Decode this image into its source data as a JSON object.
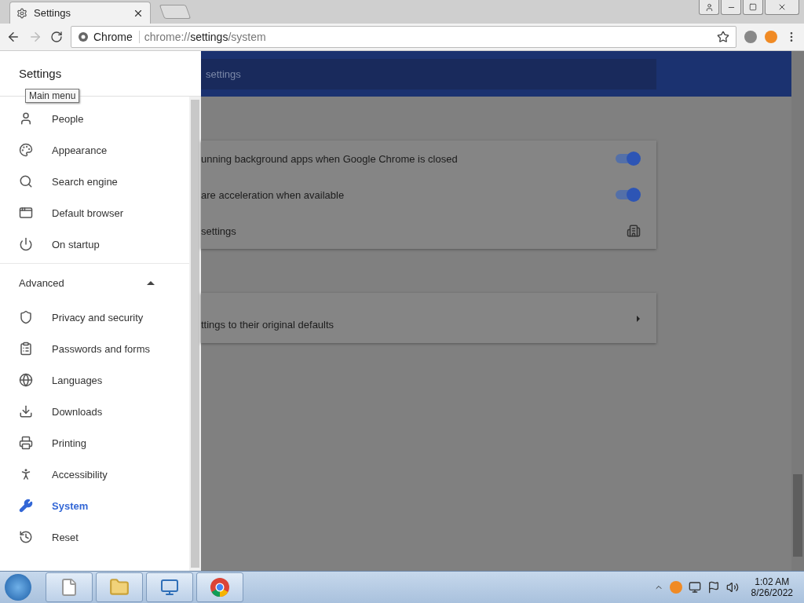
{
  "browser": {
    "tab": {
      "title": "Settings"
    },
    "address": {
      "site_label": "Chrome",
      "url_scheme": "chrome://",
      "url_host": "settings",
      "url_path": "/system"
    }
  },
  "drawer": {
    "title": "Settings",
    "tooltip": "Main menu",
    "items": [
      {
        "label": "People",
        "selected": false
      },
      {
        "label": "Appearance",
        "selected": false
      },
      {
        "label": "Search engine",
        "selected": false
      },
      {
        "label": "Default browser",
        "selected": false
      },
      {
        "label": "On startup",
        "selected": false
      }
    ],
    "advanced": {
      "label": "Advanced",
      "expanded": true
    },
    "advanced_items": [
      {
        "label": "Privacy and security",
        "selected": false
      },
      {
        "label": "Passwords and forms",
        "selected": false
      },
      {
        "label": "Languages",
        "selected": false
      },
      {
        "label": "Downloads",
        "selected": false
      },
      {
        "label": "Printing",
        "selected": false
      },
      {
        "label": "Accessibility",
        "selected": false
      },
      {
        "label": "System",
        "selected": true
      },
      {
        "label": "Reset",
        "selected": false
      }
    ]
  },
  "page": {
    "search": {
      "placeholder": "settings"
    },
    "cards": [
      {
        "rows": [
          {
            "kind": "toggle",
            "label": "unning background apps when Google Chrome is closed",
            "on": true
          },
          {
            "kind": "toggle",
            "label": "are acceleration when available",
            "on": true
          },
          {
            "kind": "external",
            "label": "settings"
          }
        ]
      },
      {
        "rows": [
          {
            "kind": "arrow",
            "label": "ttings to their original defaults"
          }
        ]
      }
    ]
  },
  "taskbar": {
    "time": "1:02 AM",
    "date": "8/26/2022"
  }
}
